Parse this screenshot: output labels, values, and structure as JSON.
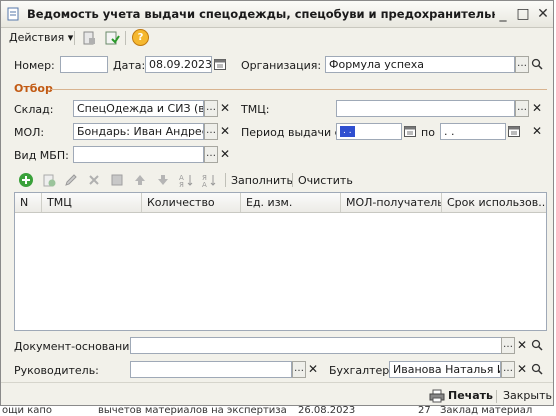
{
  "window": {
    "title": "Ведомость учета выдачи спецодежды, спецобуви и предохранительных при..."
  },
  "titlebar_buttons": [
    "_",
    "□",
    "✕"
  ],
  "toolbar": {
    "actions_label": "Действия",
    "actions_arrow": "▾",
    "help_label": "?"
  },
  "header": {
    "number_label": "Номер:",
    "number_value": "",
    "date_label": "Дата:",
    "date_value": "08.09.2023",
    "org_label": "Организация:",
    "org_value": "Формула успеха"
  },
  "filter": {
    "section_label": "Отбор",
    "warehouse_label": "Склад:",
    "warehouse_value": "СпецОдежда и СИЗ (в эк",
    "tmc_label": "ТМЦ:",
    "tmc_value": "",
    "mol_label": "МОЛ:",
    "mol_value": "Бондарь: Иван Андреевич",
    "period_label": "Период выдачи с",
    "period_from": " . . ",
    "period_to_label": "по",
    "period_to": " .  . ",
    "mbp_label": "Вид МБП:",
    "mbp_value": ""
  },
  "table_toolbar": {
    "fill_label": "Заполнить",
    "clear_label": "Очистить"
  },
  "table": {
    "columns": [
      "N",
      "ТМЦ",
      "Количество",
      "Ед. изм.",
      "МОЛ-получатель",
      "Срок использов..."
    ],
    "rows": []
  },
  "footer": {
    "basis_label": "Документ-основание:",
    "basis_value": "",
    "head_label": "Руководитель:",
    "head_value": "",
    "accountant_label": "Бухгалтер:",
    "accountant_value": "Иванова Наталья Ие",
    "print_label": "Печать",
    "close_label": "Закрыть"
  },
  "background_text": [
    "ощи капо",
    "вычетов материалов на экспертиза",
    "26.08.2023",
    "27",
    "Заклад материал"
  ],
  "colors": {
    "accent": "#c25a13",
    "selection": "#2f4fd0",
    "border": "#9fa9b7"
  }
}
